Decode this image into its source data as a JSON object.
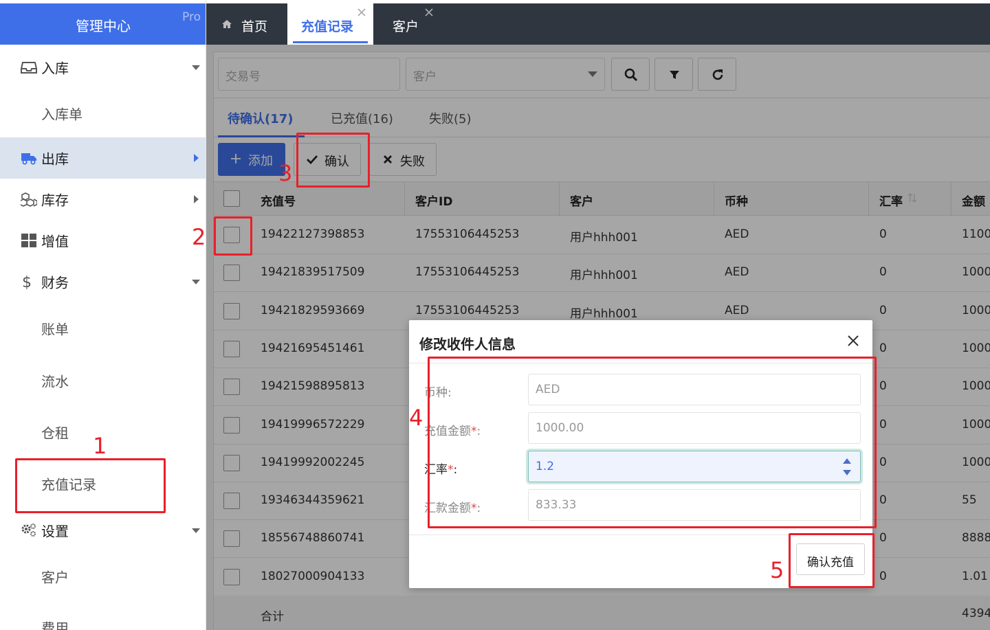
{
  "brand": {
    "title": "管理中心",
    "badge": "Pro"
  },
  "sidebar": {
    "items": [
      {
        "label": "入库",
        "icon": "inbox-icon"
      },
      {
        "label": "入库单"
      },
      {
        "label": "出库",
        "icon": "truck-icon"
      },
      {
        "label": "库存",
        "icon": "cubes-icon"
      },
      {
        "label": "增值",
        "icon": "grid-icon"
      },
      {
        "label": "财务",
        "icon": "dollar-icon"
      },
      {
        "label": "账单"
      },
      {
        "label": "流水"
      },
      {
        "label": "仓租"
      },
      {
        "label": "充值记录"
      },
      {
        "label": "设置",
        "icon": "gears-icon"
      },
      {
        "label": "客户"
      },
      {
        "label": "费用"
      }
    ]
  },
  "tabs": [
    {
      "label": "首页",
      "icon": "home-icon"
    },
    {
      "label": "充值记录"
    },
    {
      "label": "客户"
    }
  ],
  "search": {
    "transaction_placeholder": "交易号",
    "customer_placeholder": "客户"
  },
  "status_tabs": [
    {
      "label": "待确认(17)"
    },
    {
      "label": "已充值(16)"
    },
    {
      "label": "失败(5)"
    }
  ],
  "actions": {
    "add": "添加",
    "confirm": "确认",
    "fail": "失败"
  },
  "table": {
    "columns": [
      "充值号",
      "客户ID",
      "客户",
      "币种",
      "汇率",
      "金额"
    ],
    "rows": [
      [
        "19422127398853",
        "17553106445253",
        "用户hhh001",
        "AED",
        "0",
        "1100"
      ],
      [
        "19421839517509",
        "17553106445253",
        "用户hhh001",
        "AED",
        "0",
        "1000"
      ],
      [
        "19421829593669",
        "17553106445253",
        "用户hhh001",
        "AED",
        "0",
        "1000"
      ],
      [
        "19421695451461",
        "",
        "",
        "",
        "0",
        "1000"
      ],
      [
        "19421598895813",
        "",
        "",
        "",
        "0",
        "1000"
      ],
      [
        "19419996572229",
        "",
        "",
        "",
        "0",
        "1000"
      ],
      [
        "19419992002245",
        "",
        "",
        "",
        "0",
        "1000"
      ],
      [
        "19346344359621",
        "",
        "",
        "",
        "0",
        "55"
      ],
      [
        "18556748860741",
        "",
        "",
        "",
        "0",
        "8888"
      ],
      [
        "18027000904133",
        "",
        "",
        "",
        "0",
        "1.01"
      ]
    ],
    "footer_label": "合计",
    "footer_total": "4394"
  },
  "dialog": {
    "title": "修改收件人信息",
    "fields": [
      {
        "label": "币种:",
        "required": false,
        "value": "AED"
      },
      {
        "label": "充值金额",
        "required": true,
        "suffix": ":",
        "value": "1000.00"
      },
      {
        "label": "汇率",
        "required": true,
        "suffix": ":",
        "value": "1.2"
      },
      {
        "label": "汇款金额",
        "required": true,
        "suffix": ":",
        "value": "833.33"
      }
    ],
    "required_mark": "*",
    "confirm_button": "确认充值"
  },
  "annotations": [
    "1",
    "2",
    "3",
    "4",
    "5"
  ],
  "colors": {
    "accent": "#3f6fe8",
    "topbar": "#2f3640",
    "annotation": "#e8202a"
  }
}
